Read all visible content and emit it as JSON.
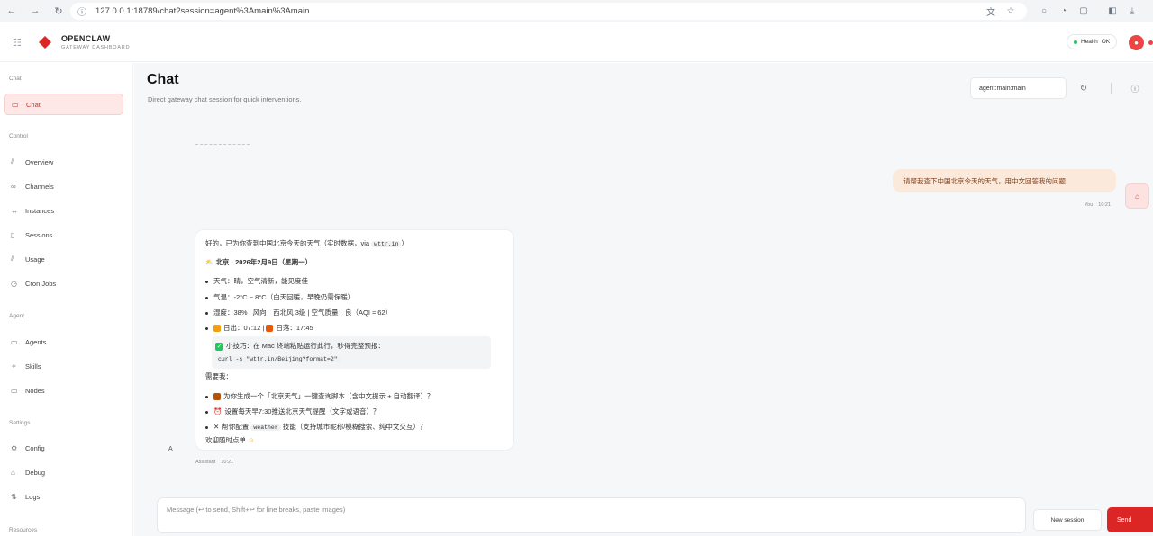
{
  "browser": {
    "url": "127.0.0.1:18789/chat?session=agent%3Amain%3Amain"
  },
  "header": {
    "brand_name": "OPENCLAW",
    "brand_sub": "GATEWAY DASHBOARD",
    "health_label": "Health",
    "health_status": "OK"
  },
  "sidebar": {
    "sections": [
      {
        "label": "Chat"
      },
      {
        "label": "Control"
      },
      {
        "label": "Agent"
      },
      {
        "label": "Settings"
      },
      {
        "label": "Resources"
      }
    ],
    "items": [
      {
        "label": "Chat",
        "icon": "message-icon",
        "active": true
      },
      {
        "label": "Overview",
        "icon": "chart-icon"
      },
      {
        "label": "Channels",
        "icon": "link-icon"
      },
      {
        "label": "Instances",
        "icon": "radio-icon"
      },
      {
        "label": "Sessions",
        "icon": "file-icon"
      },
      {
        "label": "Usage",
        "icon": "chart-icon"
      },
      {
        "label": "Cron Jobs",
        "icon": "clock-icon"
      },
      {
        "label": "Agents",
        "icon": "folder-icon"
      },
      {
        "label": "Skills",
        "icon": "sparkle-icon"
      },
      {
        "label": "Nodes",
        "icon": "monitor-icon"
      },
      {
        "label": "Config",
        "icon": "gear-icon"
      },
      {
        "label": "Debug",
        "icon": "bug-icon"
      },
      {
        "label": "Logs",
        "icon": "logs-icon"
      }
    ]
  },
  "main": {
    "title": "Chat",
    "subtitle": "Direct gateway chat session for quick interventions.",
    "session_value": "agent:main:main"
  },
  "messages": {
    "user": {
      "text": "请帮我查下中国北京今天的天气，用中文回答我的问题",
      "sender": "You",
      "time": "10:21"
    },
    "assistant": {
      "intro": "好的，已为你查到中国北京今天的天气（实时数据，via ",
      "intro_code": "wttr.in",
      "intro_end": "）",
      "heading": "北京 · 2026年2月9日（星期一）",
      "weather": "天气：晴，空气清新，能见度佳",
      "temp": "气温：-2°C ~ 8°C（白天回暖，早晚仍需保暖）",
      "humidity": "湿度：38% | 风向：西北风 3级 | 空气质量：良（AQI ≈ 62）",
      "sunrise": "日出：07:12 | ",
      "sunset": "日落：17:45",
      "tip": "小技巧：在 Mac 终端粘贴运行此行，秒得完整预报：",
      "tip_code": "curl -s \"wttr.in/Beijing?format=2\"",
      "need_more": "需要我：",
      "option1": "为你生成一个「北京天气」一键查询脚本（含中文提示 + 自动翻译）？",
      "option2": "设置每天早7:30推送北京天气提醒（文字或语音）？",
      "option3_pre": "帮你配置 ",
      "option3_code": "weather",
      "option3_post": " 技能（支持城市昵称/模糊搜索、纯中文交互）？",
      "closing": "欢迎随时点单",
      "sender": "Assistant",
      "time": "10:21",
      "avatar": "A"
    }
  },
  "composer": {
    "placeholder": "Message (↩ to send, Shift+↩ for line breaks, paste images)",
    "new_session": "New session",
    "send": "Send"
  },
  "colors": {
    "accent": "#dc2626",
    "active_bg": "#fde7e7",
    "user_bubble": "#fbe9dc",
    "health_dot": "#22c55e"
  }
}
